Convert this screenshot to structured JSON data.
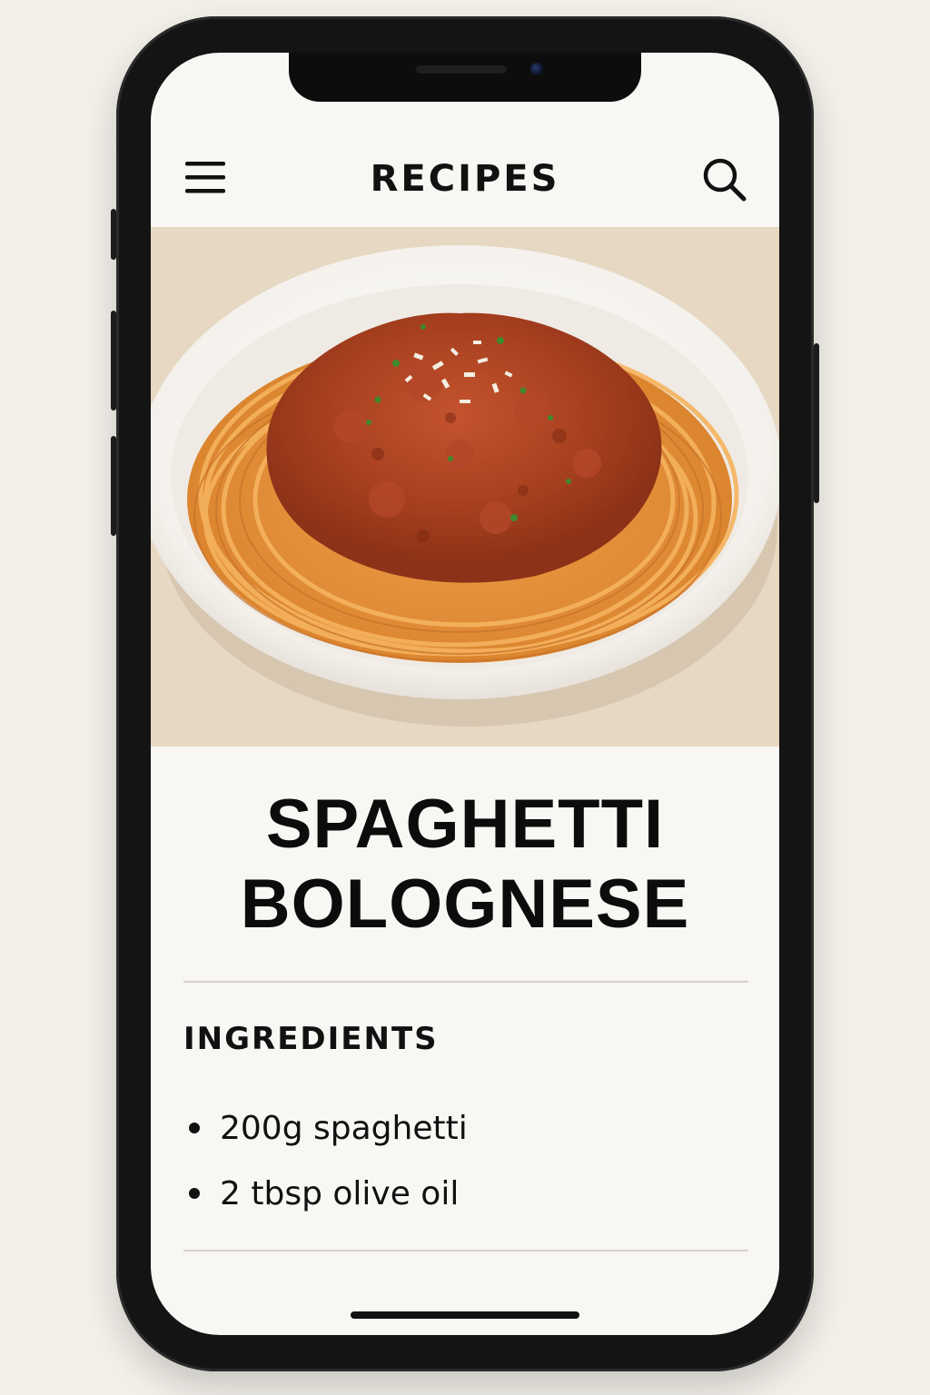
{
  "appbar": {
    "title": "RECIPES",
    "menu_icon": "hamburger-menu-icon",
    "search_icon": "search-icon"
  },
  "hero": {
    "description_icon": "spaghetti-bolognese-photo"
  },
  "recipe": {
    "title_line1": "SPAGHETTI",
    "title_line2": "BOLOGNESE"
  },
  "ingredients": {
    "heading": "INGREDIENTS",
    "items": [
      "200g spaghetti",
      "2 tbsp olive oil"
    ]
  },
  "colors": {
    "background": "#f9f7f3",
    "text": "#111111",
    "divider": "#d6d3cd",
    "phone_frame": "#141414"
  }
}
